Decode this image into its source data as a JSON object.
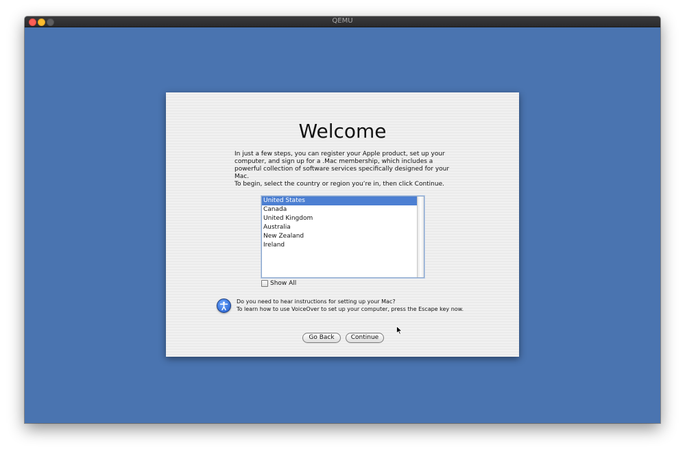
{
  "window": {
    "title": "QEMU"
  },
  "setup": {
    "heading": "Welcome",
    "intro": "In just a few steps, you can register your Apple product, set up your computer, and sign up for a .Mac membership, which includes a powerful collection of software services specifically designed for your Mac.",
    "instruction": "To begin, select the country or region you’re in, then click Continue.",
    "countries": [
      "United States",
      "Canada",
      "United Kingdom",
      "Australia",
      "New Zealand",
      "Ireland"
    ],
    "selected_country": "United States",
    "show_all_label": "Show All",
    "show_all_checked": false,
    "voiceover": {
      "line1": "Do you need to hear instructions for setting up your Mac?",
      "line2": "To learn how to use VoiceOver to set up your computer, press the Escape key now."
    },
    "go_back_label": "Go Back",
    "continue_label": "Continue"
  },
  "colors": {
    "desktop": "#4a74b0",
    "selection": "#4c7fd2"
  }
}
